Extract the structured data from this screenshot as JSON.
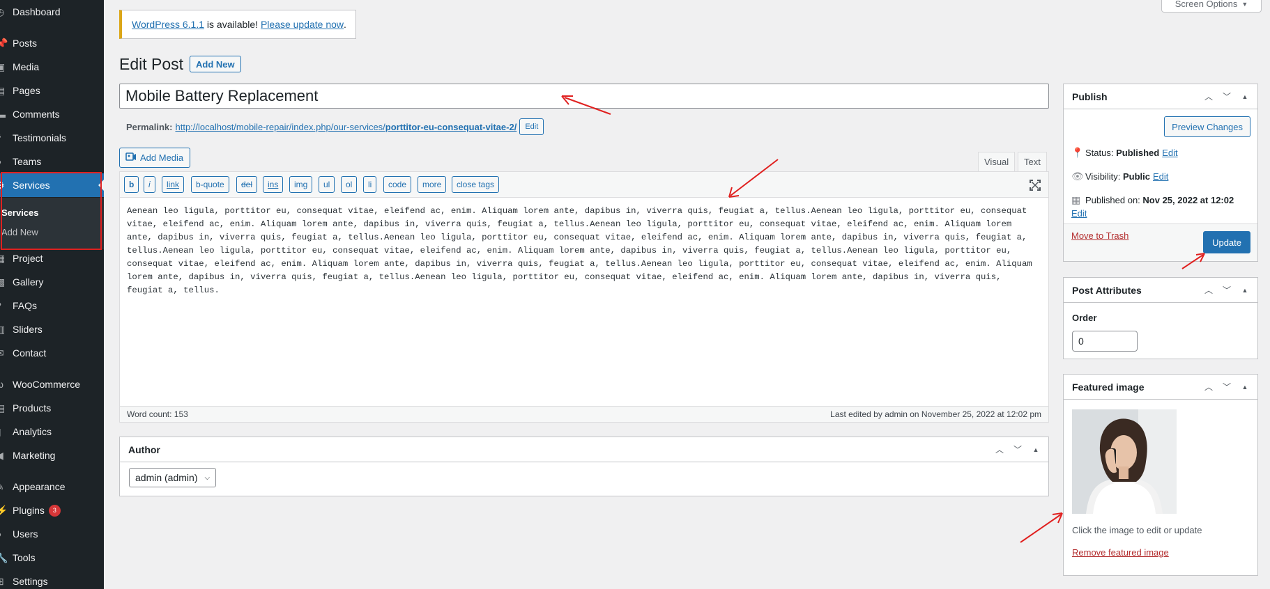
{
  "sidebar": {
    "items": [
      {
        "label": "Dashboard",
        "icon": "dashboard-icon"
      },
      {
        "label": "Posts",
        "icon": "pin-icon"
      },
      {
        "label": "Media",
        "icon": "media-icon"
      },
      {
        "label": "Pages",
        "icon": "page-icon"
      },
      {
        "label": "Comments",
        "icon": "comment-icon"
      },
      {
        "label": "Testimonials",
        "icon": "quote-icon"
      },
      {
        "label": "Teams",
        "icon": "people-icon"
      },
      {
        "label": "Services",
        "icon": "services-icon"
      },
      {
        "label": "Project",
        "icon": "project-icon"
      },
      {
        "label": "Gallery",
        "icon": "gallery-icon"
      },
      {
        "label": "FAQs",
        "icon": "faq-icon"
      },
      {
        "label": "Sliders",
        "icon": "slider-icon"
      },
      {
        "label": "Contact",
        "icon": "mail-icon"
      },
      {
        "label": "WooCommerce",
        "icon": "woo-icon"
      },
      {
        "label": "Products",
        "icon": "archive-icon"
      },
      {
        "label": "Analytics",
        "icon": "chart-icon"
      },
      {
        "label": "Marketing",
        "icon": "megaphone-icon"
      },
      {
        "label": "Appearance",
        "icon": "brush-icon"
      },
      {
        "label": "Plugins",
        "icon": "plugin-icon",
        "badge": "3"
      },
      {
        "label": "Users",
        "icon": "user-icon"
      },
      {
        "label": "Tools",
        "icon": "wrench-icon"
      },
      {
        "label": "Settings",
        "icon": "settings-icon"
      }
    ],
    "submenu": {
      "current": "Services",
      "add_new": "Add New"
    }
  },
  "screen_options": "Screen Options",
  "notice": {
    "version_link": "WordPress 6.1.1",
    "middle": " is available! ",
    "update_link": "Please update now",
    "end": "."
  },
  "page": {
    "title": "Edit Post",
    "add_new": "Add New"
  },
  "post": {
    "title": "Mobile Battery Replacement",
    "permalink_label": "Permalink:",
    "permalink_base": "http://localhost/mobile-repair/index.php/our-services/",
    "permalink_slug": "porttitor-eu-consequat-vitae-2/",
    "permalink_edit": "Edit"
  },
  "editor": {
    "add_media": "Add Media",
    "tab_visual": "Visual",
    "tab_text": "Text",
    "quicktags": [
      "b",
      "i",
      "link",
      "b-quote",
      "del",
      "ins",
      "img",
      "ul",
      "ol",
      "li",
      "code",
      "more",
      "close tags"
    ],
    "content": "Aenean leo ligula, porttitor eu, consequat vitae, eleifend ac, enim. Aliquam lorem ante, dapibus in, viverra quis, feugiat a, tellus.Aenean leo ligula, porttitor eu, consequat vitae, eleifend ac, enim. Aliquam lorem ante, dapibus in, viverra quis, feugiat a, tellus.Aenean leo ligula, porttitor eu, consequat vitae, eleifend ac, enim. Aliquam lorem ante, dapibus in, viverra quis, feugiat a, tellus.Aenean leo ligula, porttitor eu, consequat vitae, eleifend ac, enim. Aliquam lorem ante, dapibus in, viverra quis, feugiat a, tellus.Aenean leo ligula, porttitor eu, consequat vitae, eleifend ac, enim. Aliquam lorem ante, dapibus in, viverra quis, feugiat a, tellus.Aenean leo ligula, porttitor eu, consequat vitae, eleifend ac, enim. Aliquam lorem ante, dapibus in, viverra quis, feugiat a, tellus.Aenean leo ligula, porttitor eu, consequat vitae, eleifend ac, enim. Aliquam lorem ante, dapibus in, viverra quis, feugiat a, tellus.Aenean leo ligula, porttitor eu, consequat vitae, eleifend ac, enim. Aliquam lorem ante, dapibus in, viverra quis, feugiat a, tellus.",
    "word_count": "Word count: 153",
    "last_edited": "Last edited by admin on November 25, 2022 at 12:02 pm"
  },
  "author": {
    "title": "Author",
    "value": "admin (admin)"
  },
  "publish": {
    "title": "Publish",
    "preview": "Preview Changes",
    "status_label": "Status: ",
    "status_value": "Published",
    "visibility_label": "Visibility: ",
    "visibility_value": "Public",
    "published_label": "Published on: ",
    "published_value": "Nov 25, 2022 at 12:02",
    "edit": "Edit",
    "trash": "Move to Trash",
    "update": "Update"
  },
  "attributes": {
    "title": "Post Attributes",
    "order_label": "Order",
    "order_value": "0"
  },
  "featured": {
    "title": "Featured image",
    "hint": "Click the image to edit or update",
    "remove": "Remove featured image"
  },
  "colors": {
    "accent": "#2271b1",
    "sidebar": "#1d2327",
    "annotation": "#e0201f"
  }
}
